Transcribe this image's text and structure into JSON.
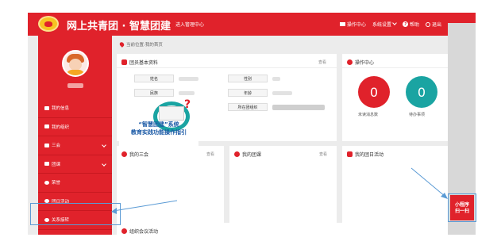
{
  "header": {
    "site_title": "网上共青团 · 智慧团建",
    "mgmt_link": "进入管理中心",
    "tools": {
      "ops": "操作中心",
      "settings": "系统设置",
      "help": "帮助",
      "logout": "退出"
    }
  },
  "sidebar": {
    "items": [
      {
        "label": "我的信息"
      },
      {
        "label": "我的组织"
      },
      {
        "label": "三会"
      },
      {
        "label": "团课"
      },
      {
        "label": "荣誉"
      },
      {
        "label": "团日活动"
      },
      {
        "label": "关系接转"
      }
    ]
  },
  "breadcrumb": "当前位置:我的首页",
  "profile_panel": {
    "title": "团员基本资料",
    "view": "查看",
    "labels": {
      "name": "姓名",
      "gender": "性别",
      "ethnicity": "民族",
      "age": "年龄",
      "league_age": "团龄",
      "org": "所在团组织"
    }
  },
  "ops_panel": {
    "title": "操作中心",
    "view": "查看",
    "unread_count": "0",
    "unread_label": "未读消息数",
    "todo_count": "0",
    "todo_label": "待办事项",
    "unread_color": "#e0222b",
    "todo_color": "#1aa4a2"
  },
  "panels": {
    "three_meetings": {
      "title": "我的三会",
      "view": "查看"
    },
    "league_class": {
      "title": "我的团课",
      "view": "查看"
    },
    "league_day": {
      "title": "我的团日活动",
      "view": "查看"
    },
    "org_meeting": {
      "title": "组织会议活动"
    }
  },
  "guide": {
    "line1": "“智慧团建”系统",
    "line2": "教育实践功能操作指引"
  },
  "mini_program": {
    "line1": "小程序",
    "line2": "扫一扫"
  }
}
